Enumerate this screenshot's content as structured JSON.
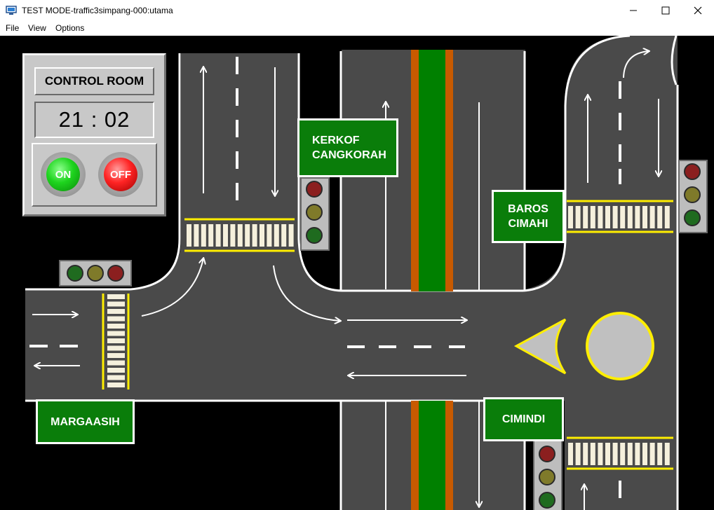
{
  "window": {
    "title": "TEST MODE-traffic3simpang-000:utama",
    "minimize_glyph": "—",
    "maximize_glyph": "☐",
    "close_glyph": "✕",
    "icon": "app-monitor-icon"
  },
  "menu": {
    "items": [
      {
        "label": "File"
      },
      {
        "label": "View"
      },
      {
        "label": "Options"
      }
    ]
  },
  "control_room": {
    "title": "CONTROL ROOM",
    "clock": "21 : 02",
    "on_label": "ON",
    "off_label": "OFF"
  },
  "signs": {
    "kerkof": "KERKOF\nCANGKORAH",
    "baros": "BAROS\nCIMAHI",
    "margaasih": "MARGAASIH",
    "cimindi": "CIMINDI"
  },
  "colors": {
    "road": "#4a4a4a",
    "median_green": "#008000",
    "median_orange": "#c85a00",
    "sign_green": "#0a7d0a",
    "zebra_line": "#ffee00",
    "light_red": "#8b1f1f",
    "light_yellow": "#7f7a2a",
    "light_green": "#1f6b1f"
  },
  "traffic_lights": [
    {
      "name": "kerkof-signal",
      "red": "off",
      "yellow": "off",
      "green": "off"
    },
    {
      "name": "baros-signal",
      "red": "off",
      "yellow": "off",
      "green": "off"
    },
    {
      "name": "margaasih-signal",
      "red": "off",
      "yellow": "off",
      "green": "off"
    },
    {
      "name": "cimindi-signal",
      "red": "off",
      "yellow": "off",
      "green": "off"
    }
  ]
}
